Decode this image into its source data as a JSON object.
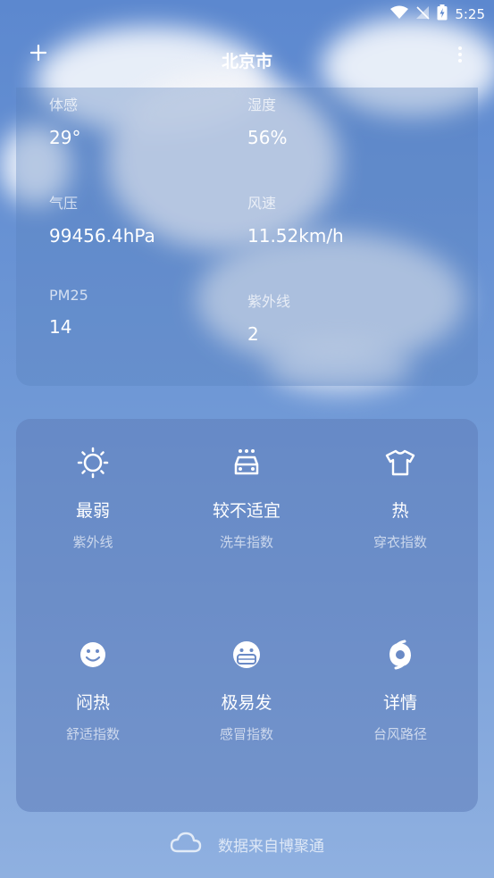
{
  "status": {
    "time": "5:25",
    "icons": [
      "wifi-icon",
      "no-signal-icon",
      "battery-charging-icon"
    ]
  },
  "header": {
    "title": "北京市",
    "add_icon": "plus-icon",
    "more_icon": "more-vertical-icon"
  },
  "details": [
    {
      "label": "体感",
      "value": "29°"
    },
    {
      "label": "湿度",
      "value": "56%"
    },
    {
      "label": "气压",
      "value": "99456.4hPa"
    },
    {
      "label": "风速",
      "value": "11.52km/h"
    },
    {
      "label": "PM25",
      "value": "14"
    },
    {
      "label": "紫外线",
      "value": "2"
    }
  ],
  "life_index": [
    {
      "icon": "sun-icon",
      "value": "最弱",
      "name": "紫外线"
    },
    {
      "icon": "car-wash-icon",
      "value": "较不适宜",
      "name": "洗车指数"
    },
    {
      "icon": "tshirt-icon",
      "value": "热",
      "name": "穿衣指数"
    },
    {
      "icon": "smiley-icon",
      "value": "闷热",
      "name": "舒适指数"
    },
    {
      "icon": "mask-face-icon",
      "value": "极易发",
      "name": "感冒指数"
    },
    {
      "icon": "typhoon-icon",
      "value": "详情",
      "name": "台风路径"
    }
  ],
  "source": {
    "icon": "cloud-icon",
    "text": "数据来自博聚通"
  },
  "colors": {
    "background_top": "#5c88cf",
    "background_bottom": "#8fb0e0",
    "text": "#ffffff"
  }
}
